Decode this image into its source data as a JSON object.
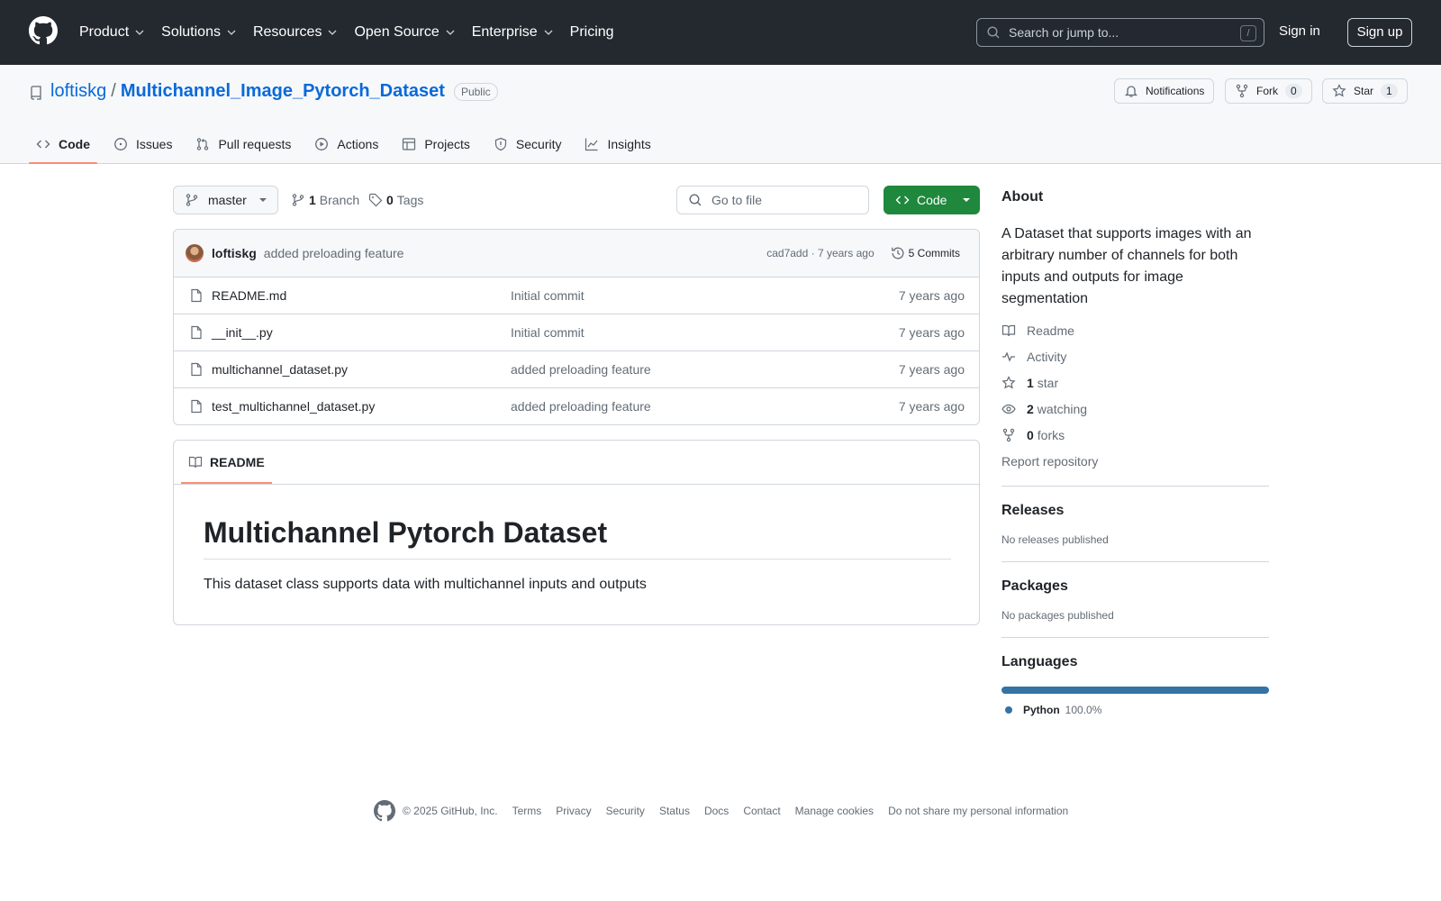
{
  "header": {
    "nav": [
      {
        "label": "Product",
        "dropdown": true
      },
      {
        "label": "Solutions",
        "dropdown": true
      },
      {
        "label": "Resources",
        "dropdown": true
      },
      {
        "label": "Open Source",
        "dropdown": true
      },
      {
        "label": "Enterprise",
        "dropdown": true
      },
      {
        "label": "Pricing",
        "dropdown": false
      }
    ],
    "search_placeholder": "Search or jump to...",
    "search_shortcut": "/",
    "sign_in": "Sign in",
    "sign_up": "Sign up"
  },
  "repo": {
    "owner": "loftiskg",
    "separator": "/",
    "name": "Multichannel_Image_Pytorch_Dataset",
    "visibility": "Public",
    "notifications_label": "Notifications",
    "fork_label": "Fork",
    "fork_count": "0",
    "star_label": "Star",
    "star_count": "1"
  },
  "tabs": [
    {
      "label": "Code",
      "icon": "code-icon",
      "active": true
    },
    {
      "label": "Issues",
      "icon": "issue-icon",
      "active": false
    },
    {
      "label": "Pull requests",
      "icon": "pull-request-icon",
      "active": false
    },
    {
      "label": "Actions",
      "icon": "play-icon",
      "active": false
    },
    {
      "label": "Projects",
      "icon": "table-icon",
      "active": false
    },
    {
      "label": "Security",
      "icon": "shield-icon",
      "active": false
    },
    {
      "label": "Insights",
      "icon": "graph-icon",
      "active": false
    }
  ],
  "toolbar": {
    "branch": "master",
    "branch_count": "1",
    "branch_label": "Branch",
    "tag_count": "0",
    "tag_label": "Tags",
    "goto_placeholder": "Go to file",
    "code_button": "Code"
  },
  "commit": {
    "author": "loftiskg",
    "message": "added preloading feature",
    "hash_age": "cad7add · 7 years ago",
    "commits_label": "5 Commits"
  },
  "files": [
    {
      "name": "README.md",
      "message": "Initial commit",
      "age": "7 years ago"
    },
    {
      "name": "__init__.py",
      "message": "Initial commit",
      "age": "7 years ago"
    },
    {
      "name": "multichannel_dataset.py",
      "message": "added preloading feature",
      "age": "7 years ago"
    },
    {
      "name": "test_multichannel_dataset.py",
      "message": "added preloading feature",
      "age": "7 years ago"
    }
  ],
  "readme": {
    "tab_label": "README",
    "heading": "Multichannel Pytorch Dataset",
    "body": "This dataset class supports data with multichannel inputs and outputs"
  },
  "sidebar": {
    "about_title": "About",
    "description": "A Dataset that supports images with an arbitrary number of channels for both inputs and outputs for image segmentation",
    "readme": "Readme",
    "activity": "Activity",
    "stars_count": "1",
    "stars_label": "star",
    "watching_count": "2",
    "watching_label": "watching",
    "forks_count": "0",
    "forks_label": "forks",
    "report": "Report repository",
    "releases_title": "Releases",
    "releases_text": "No releases published",
    "packages_title": "Packages",
    "packages_text": "No packages published",
    "languages_title": "Languages",
    "language_name": "Python",
    "language_percent": "100.0%",
    "language_color": "#3572a5"
  },
  "footer": {
    "copyright": "© 2025 GitHub, Inc.",
    "links": [
      "Terms",
      "Privacy",
      "Security",
      "Status",
      "Docs",
      "Contact",
      "Manage cookies",
      "Do not share my personal information"
    ]
  },
  "colors": {
    "header_bg": "#24292f",
    "link": "#0969da",
    "primary_button": "#1f883d",
    "active_tab_underline": "#fd8c73"
  }
}
